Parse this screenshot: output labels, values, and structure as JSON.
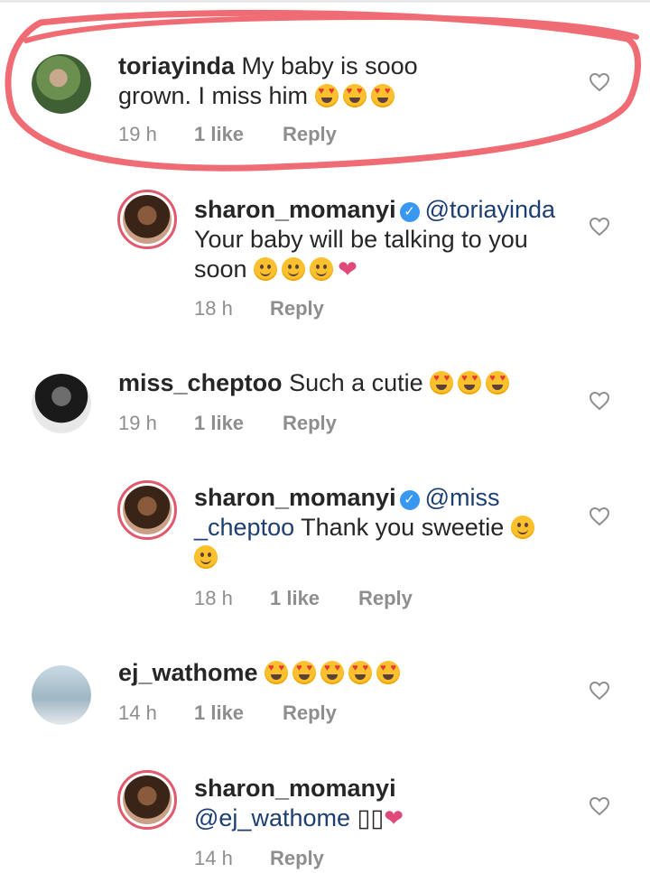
{
  "colors": {
    "mention": "#1c3e73",
    "meta_gray": "#8e8e8e",
    "annotation_red": "#f06c74",
    "verified_blue": "#3897f0"
  },
  "comments": [
    {
      "username": "toriayinda",
      "text": "My baby is sooo grown. I miss him",
      "emojis": [
        "heart-eyes-emoji",
        "heart-eyes-emoji",
        "heart-eyes-emoji"
      ],
      "time": "19 h",
      "likes": "1 like",
      "reply": "Reply"
    },
    {
      "username": "sharon_momanyi",
      "mention": "@toriayinda",
      "text": "Your baby will be talking to you soon",
      "emojis": [
        "smile-emoji",
        "smile-emoji",
        "smile-emoji",
        "pink-heart"
      ],
      "time": "18 h",
      "likes": "",
      "reply": "Reply"
    },
    {
      "username": "miss_cheptoo",
      "text": "Such a cutie",
      "emojis": [
        "heart-eyes-emoji",
        "heart-eyes-emoji",
        "heart-eyes-emoji"
      ],
      "time": "19 h",
      "likes": "1 like",
      "reply": "Reply"
    },
    {
      "username": "sharon_momanyi",
      "mention_part1": "@miss",
      "mention_part2": "_cheptoo",
      "text": "Thank you sweetie",
      "emojis": [
        "smile-emoji",
        "smile-emoji"
      ],
      "time": "18 h",
      "likes": "1 like",
      "reply": "Reply"
    },
    {
      "username": "ej_wathome",
      "text": "",
      "emojis": [
        "heart-eyes-emoji",
        "heart-eyes-emoji",
        "heart-eyes-emoji",
        "heart-eyes-emoji",
        "heart-eyes-emoji"
      ],
      "time": "14 h",
      "likes": "1 like",
      "reply": "Reply"
    },
    {
      "username": "sharon_momanyi",
      "mention": "@ej_wathome",
      "text": "▯▯",
      "emojis": [
        "pink-heart"
      ],
      "time": "14 h",
      "likes": "",
      "reply": "Reply"
    }
  ]
}
